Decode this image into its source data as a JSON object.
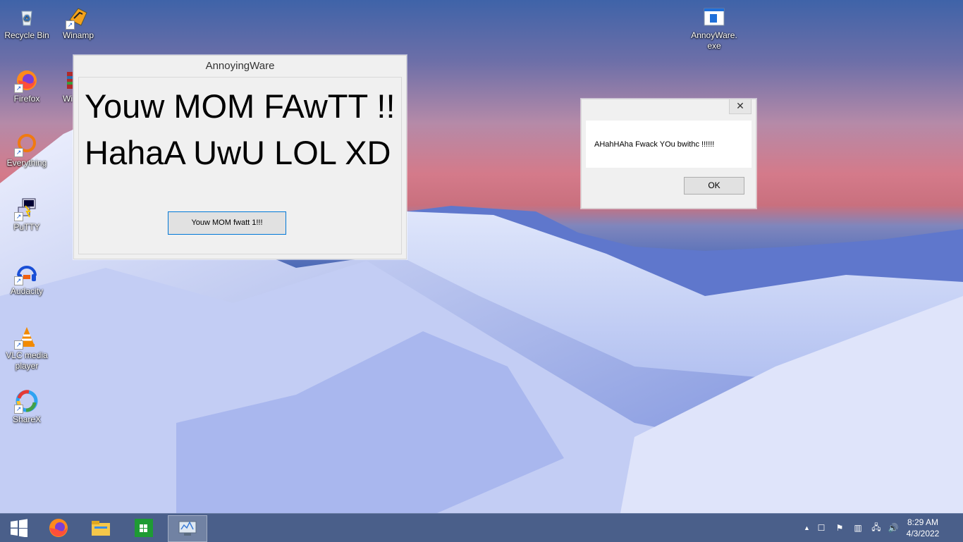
{
  "desktop": {
    "icons": [
      {
        "label": "Recycle Bin",
        "icon": "recycle-bin-icon"
      },
      {
        "label": "Winamp",
        "icon": "winamp-icon"
      },
      {
        "label": "Firefox",
        "icon": "firefox-icon"
      },
      {
        "label": "Wi",
        "icon": "winrar-icon"
      },
      {
        "label": "Everything",
        "icon": "everything-icon"
      },
      {
        "label": "PuTTY",
        "icon": "putty-icon"
      },
      {
        "label": "Audacity",
        "icon": "audacity-icon"
      },
      {
        "label": "VLC media player",
        "icon": "vlc-icon"
      },
      {
        "label": "ShareX",
        "icon": "sharex-icon"
      },
      {
        "label": "AnnoyWare.exe",
        "icon": "exe-file-icon"
      }
    ]
  },
  "main_window": {
    "title": "AnnoyingWare",
    "line1": "Youw MOM FAwTT !!",
    "line2": "HahaA UwU LOL XD",
    "button_label": "Youw MOM fwatt 1!!!"
  },
  "message_box": {
    "text": "AHahHAha Fwack YOu bwithc !!!!!!",
    "ok_label": "OK",
    "close_symbol": "✕"
  },
  "taskbar": {
    "items": [
      "start-icon",
      "firefox-icon",
      "file-explorer-icon",
      "store-icon",
      "annoyware-app-icon"
    ],
    "time": "8:29 AM",
    "date": "4/3/2022"
  },
  "colors": {
    "taskbar": "#4a5f8a",
    "window_bg": "#f0f0f0",
    "focus_border": "#0078d7"
  }
}
